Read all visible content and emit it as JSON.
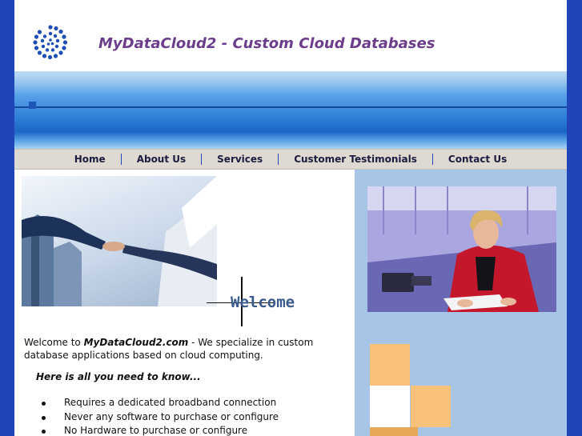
{
  "header": {
    "title": "MyDataCloud2 - Custom Cloud Databases",
    "logo_icon": "spiral-dots-logo-icon"
  },
  "nav": {
    "items": [
      {
        "label": "Home"
      },
      {
        "label": "About Us"
      },
      {
        "label": "Services"
      },
      {
        "label": "Customer Testimonials"
      },
      {
        "label": "Contact Us"
      }
    ]
  },
  "main": {
    "welcome_heading": "Welcome",
    "intro_prefix": "Welcome to ",
    "intro_brand": "MyDataCloud2.com",
    "intro_suffix": " - We specialize in custom database applications based on cloud computing.",
    "subheading": "Here is all you need to know...",
    "features": [
      "Requires a dedicated broadband connection",
      "Never any software to purchase or configure",
      "No Hardware to purchase or configure"
    ]
  },
  "colors": {
    "outer_background": "#1f45b8",
    "title_color": "#6b3d8a",
    "nav_background": "#dedad2",
    "sidebar_background": "#a7c5e6",
    "accent_tile": "#f9c27a"
  }
}
